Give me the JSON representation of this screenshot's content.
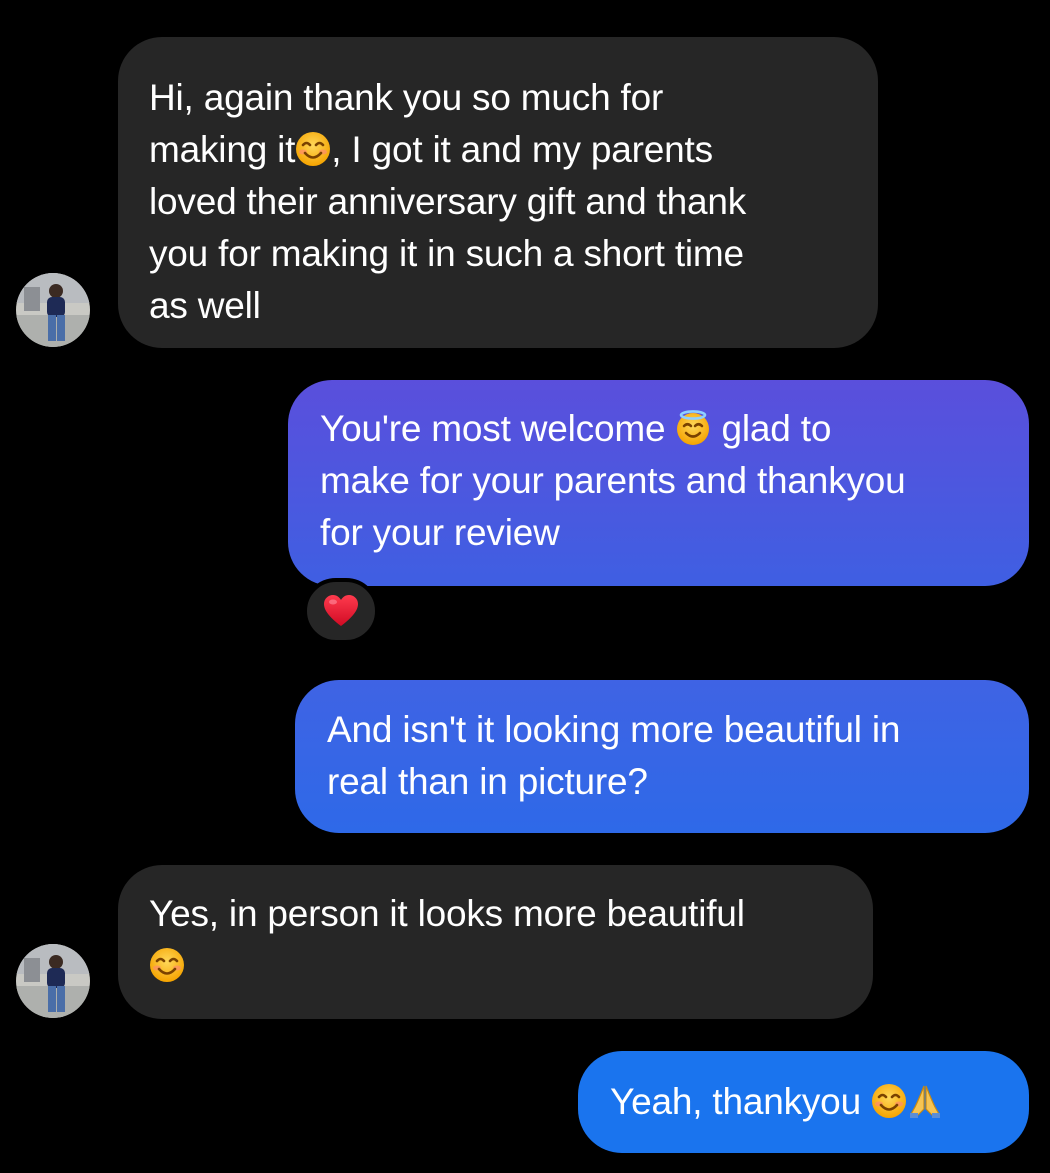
{
  "messages": [
    {
      "id": "m1",
      "direction": "incoming",
      "lines": [
        "Hi, again thank you so much for",
        "making it",
        ", I got it and my parents",
        "loved their anniversary gift and thank",
        "you for making it in such a short time",
        "as well"
      ],
      "emoji": [
        "smiling-face-icon"
      ]
    },
    {
      "id": "m2",
      "direction": "outgoing",
      "lines": [
        "You're most welcome ",
        " glad to",
        "make for your parents and thankyou",
        "for your review"
      ],
      "emoji": [
        "smiling-face-with-halo-icon"
      ],
      "reaction": "heart-icon"
    },
    {
      "id": "m3",
      "direction": "outgoing",
      "lines": [
        "And isn't it looking more beautiful in",
        "real than in picture?"
      ]
    },
    {
      "id": "m4",
      "direction": "incoming",
      "lines": [
        "Yes, in person it looks more beautiful"
      ],
      "emoji": [
        "smiling-face-icon"
      ]
    },
    {
      "id": "m5",
      "direction": "outgoing",
      "lines": [
        "Yeah, thankyou "
      ],
      "emoji": [
        "smiling-face-icon",
        "folded-hands-icon"
      ]
    }
  ],
  "colors": {
    "background": "#000000",
    "incoming_bubble": "#262626",
    "outgoing_gradient_top": "#5a4fdc",
    "outgoing_gradient_bottom": "#1a74ee",
    "reaction_heart": "#e0102a"
  }
}
